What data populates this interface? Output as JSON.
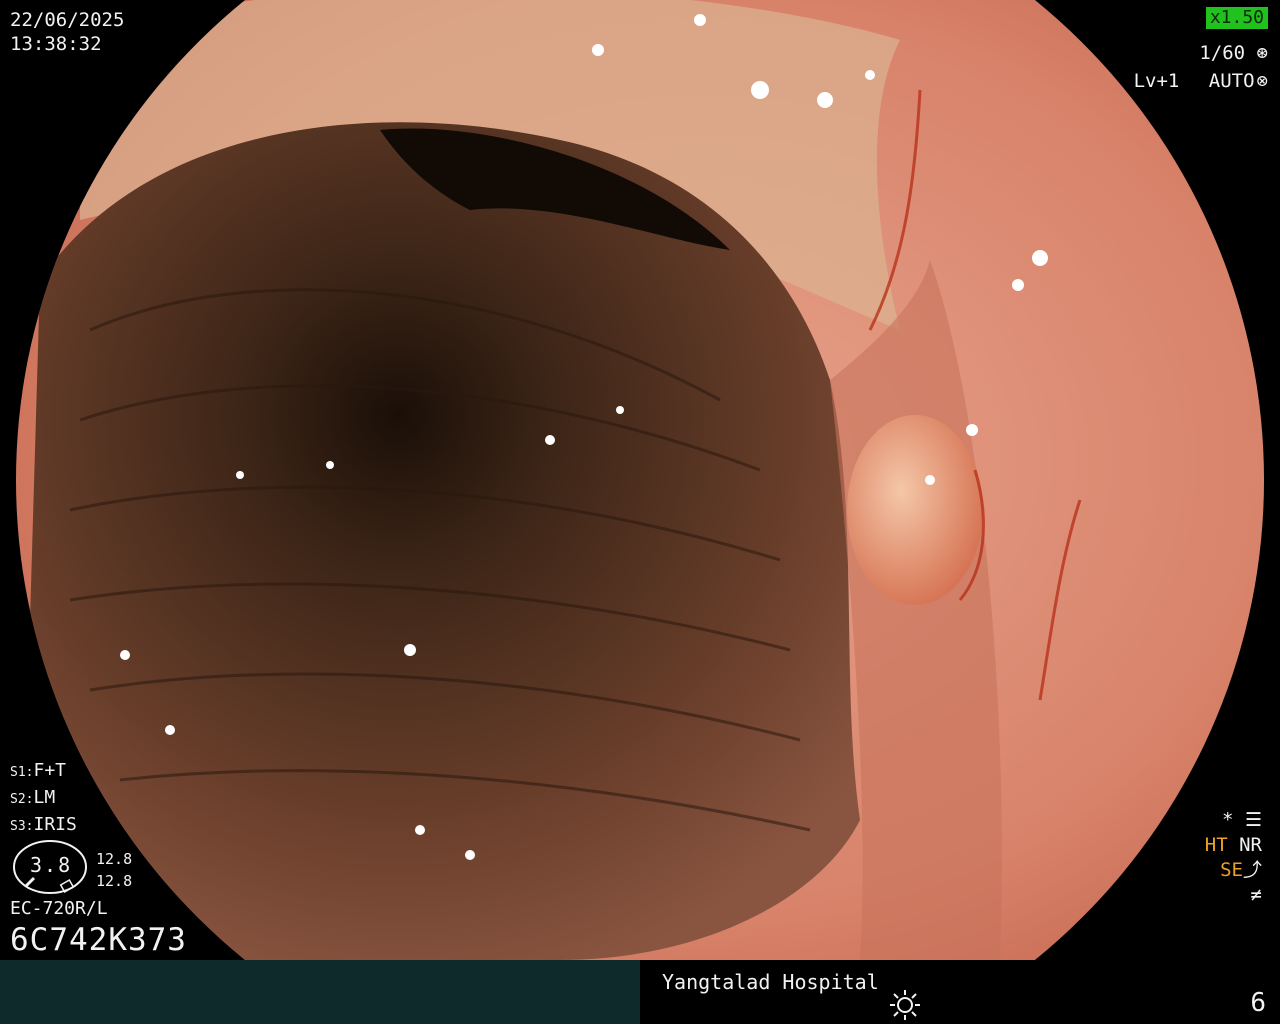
{
  "image": {
    "description_kind": "endoscopic colon view",
    "icons": [
      "shutter-icon",
      "auto-exposure-icon",
      "structure-enhancement-icon",
      "brightness-icon"
    ]
  },
  "osd": {
    "date": "22/06/2025",
    "time": "13:38:32",
    "zoom": "x1.50",
    "shutter": "1/60",
    "level": "Lv+1",
    "mode": "AUTO",
    "s1_key": "S1:",
    "s1_val": "F+T",
    "s2_key": "S2:",
    "s2_val": "LM",
    "s3_key": "S3:",
    "s3_val": "IRIS",
    "gauge_value": "3.8",
    "gauge_top": "12.8",
    "gauge_bottom": "12.8",
    "scope_model": "EC-720R/L",
    "serial": "6C742K373",
    "ind_star": "*",
    "ind_ht": "HT",
    "ind_nr": "NR",
    "ind_se": "SE",
    "hospital": "Yangtalad Hospital",
    "page": "6"
  },
  "colors": {
    "zoom_badge": "#21c21e",
    "indicator_orange": "#f0a020",
    "bottom_bar": "#0e2a2a",
    "mucosa": "#d9806a",
    "lumen": "#3a1f12"
  }
}
